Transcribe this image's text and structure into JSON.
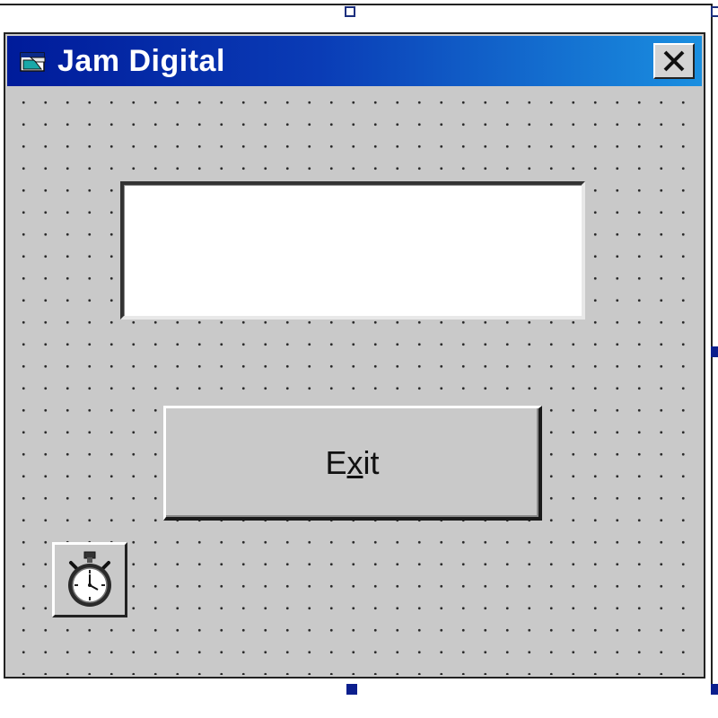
{
  "window": {
    "title": "Jam Digital",
    "icon": "form-icon",
    "close_icon": "close-icon"
  },
  "text_box": {
    "value": ""
  },
  "exit_button": {
    "label_prefix": "E",
    "label_mnemonic": "x",
    "label_suffix": "it"
  },
  "timer": {
    "icon": "stopwatch-icon"
  },
  "colors": {
    "title_bar_start": "#001b9a",
    "title_bar_end": "#1a8fe0",
    "form_background": "#c9c9c9",
    "selection_handle": "#0c1f8e"
  }
}
